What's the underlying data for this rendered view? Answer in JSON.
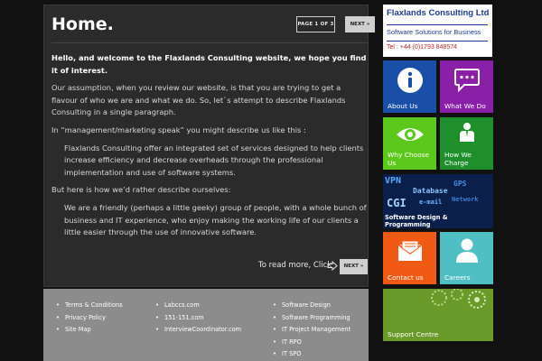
{
  "main": {
    "title": "Home.",
    "page_indicator": "PAGE 1 OF 3",
    "next_label": "NEXT »",
    "lead": "Hello, and welcome to the Flaxlands Consulting website, we hope you find it of interest.",
    "paragraphs": [
      "Our assumption, when you review our website, is that you are trying to get a flavour of who we are and what we do.  So, let`s attempt to describe Flaxlands Consulting in a single paragraph.",
      "In “management/marketing speak” you might describe us like this :",
      "Flaxlands Consulting offer an integrated set of services designed to help clients increase efficiency and decrease overheads through the professional implementation and use of software systems.",
      "But here is how we’d rather describe ourselves:",
      "We are a friendly (perhaps a little geeky) group of people, with a whole bunch of business and IT experience, who enjoy making the working life of our clients a little easier through the use of innovative software."
    ],
    "read_more": "To read more, Click",
    "read_more_next": "NEXT »"
  },
  "footer": {
    "col1": [
      "Terms & Conditions",
      "Privacy Policy",
      "Site Map"
    ],
    "col2": [
      "Labccs.com",
      "151-151.com",
      "InterviewCoordinator.com"
    ],
    "col3": [
      "Software Design",
      "Software Programming",
      "IT Project Management",
      "IT RPO",
      "IT SPO"
    ]
  },
  "logo": {
    "title": "Flaxlands Consulting Ltd",
    "subtitle": "Software Solutions for Business",
    "tel": "Tel : +44 (0)1793 848574"
  },
  "tiles": {
    "about": "About Us",
    "what_we_do": "What We Do",
    "why_choose": "Why Choose Us",
    "how_we_charge": "How We Charge",
    "software": "Software Design & Programming",
    "software_words": [
      "VPN",
      "Database",
      "GPS",
      "CGI",
      "e-mail",
      "Network"
    ],
    "contact": "Contact us",
    "careers": "Careers",
    "support": "Support Centre"
  },
  "colors": {
    "about": "#1a4fa8",
    "what_we_do": "#8b20a8",
    "why_choose": "#5cc81c",
    "how_we_charge": "#1e8f2a",
    "contact": "#f05a14",
    "careers": "#4fbfc4",
    "support": "#6a9a2a"
  }
}
